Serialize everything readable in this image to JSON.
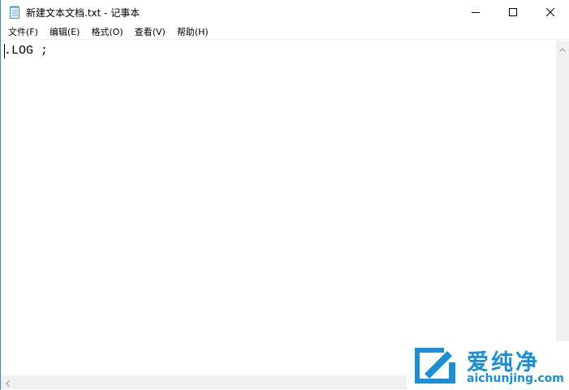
{
  "window": {
    "title": "新建文本文档.txt - 记事本",
    "icon": "notepad-icon"
  },
  "window_controls": {
    "minimize_icon": "minimize-icon",
    "maximize_icon": "maximize-icon",
    "close_icon": "close-icon"
  },
  "menu": {
    "items": [
      {
        "label": "文件(F)"
      },
      {
        "label": "编辑(E)"
      },
      {
        "label": "格式(O)"
      },
      {
        "label": "查看(V)"
      },
      {
        "label": "帮助(H)"
      }
    ]
  },
  "editor": {
    "content": ".LOG ;"
  },
  "watermark": {
    "text_cn": "爱纯净",
    "text_en": "aichunjing.com"
  },
  "colors": {
    "accent": "#1a8fd8",
    "border": "#3c8dbc",
    "scrollbar": "#f0f0f0"
  }
}
